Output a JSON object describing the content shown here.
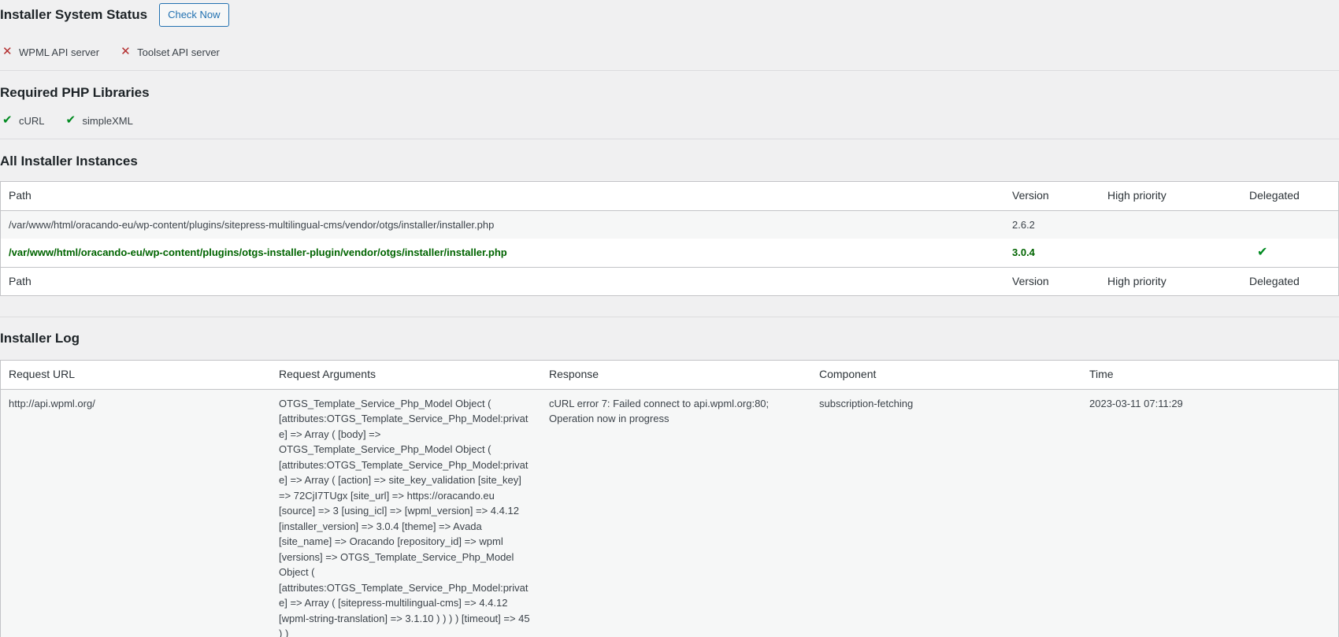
{
  "status": {
    "title": "Installer System Status",
    "check_button": "Check Now",
    "servers": [
      {
        "label": "WPML API server",
        "ok": false
      },
      {
        "label": "Toolset API server",
        "ok": false
      }
    ]
  },
  "libs": {
    "title": "Required PHP Libraries",
    "items": [
      {
        "label": "cURL",
        "ok": true
      },
      {
        "label": "simpleXML",
        "ok": true
      }
    ]
  },
  "instances": {
    "title": "All Installer Instances",
    "columns": [
      "Path",
      "Version",
      "High priority",
      "Delegated"
    ],
    "rows": [
      {
        "path": "/var/www/html/oracando-eu/wp-content/plugins/sitepress-multilingual-cms/vendor/otgs/installer/installer.php",
        "version": "2.6.2",
        "high_priority": "",
        "delegated": ""
      },
      {
        "path": "/var/www/html/oracando-eu/wp-content/plugins/otgs-installer-plugin/vendor/otgs/installer/installer.php",
        "version": "3.0.4",
        "high_priority": "",
        "delegated": "✔"
      }
    ]
  },
  "log": {
    "title": "Installer Log",
    "columns": [
      "Request URL",
      "Request Arguments",
      "Response",
      "Component",
      "Time"
    ],
    "rows": [
      {
        "url": "http://api.wpml.org/",
        "args": "OTGS_Template_Service_Php_Model Object ( [attributes:OTGS_Template_Service_Php_Model:private] => Array ( [body] => OTGS_Template_Service_Php_Model Object ( [attributes:OTGS_Template_Service_Php_Model:private] => Array ( [action] => site_key_validation [site_key] => 72CjI7TUgx [site_url] => https://oracando.eu [source] => 3 [using_icl] => [wpml_version] => 4.4.12 [installer_version] => 3.0.4 [theme] => Avada [site_name] => Oracando [repository_id] => wpml [versions] => OTGS_Template_Service_Php_Model Object ( [attributes:OTGS_Template_Service_Php_Model:private] => Array ( [sitepress-multilingual-cms] => 4.4.12 [wpml-string-translation] => 3.1.10 ) ) ) ) [timeout] => 45 ) )",
        "response": "cURL error 7: Failed connect to api.wpml.org:80; Operation now in progress",
        "component": "subscription-fetching",
        "time": "2023-03-11 07:11:29"
      }
    ]
  },
  "colors": {
    "background": "#f0f0f1",
    "accent": "#2271b1",
    "error": "#b32d2e",
    "success": "#008a20",
    "active_row": "#006400"
  },
  "icons": {
    "fail": "close-icon",
    "ok": "checkmark-icon"
  }
}
